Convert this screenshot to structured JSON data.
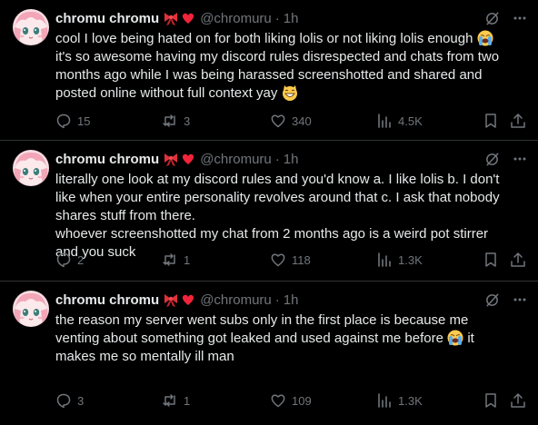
{
  "tweets": [
    {
      "author": {
        "name": "chromu chromu",
        "handle": "@chromuru",
        "time": "1h"
      },
      "lines": [
        "cool I love being hated on for both liking lolis or not liking lolis enough",
        "it's so awesome having my discord rules disrespected and chats from two",
        "months ago while I was being harassed screenshotted and shared and",
        "posted online without full context yay"
      ],
      "stats": {
        "replies": "15",
        "reposts": "3",
        "likes": "340",
        "views": "4.5K"
      }
    },
    {
      "author": {
        "name": "chromu chromu",
        "handle": "@chromuru",
        "time": "1h"
      },
      "lines": [
        "literally one look at my discord rules and you'd know a. I like lolis b. I don't",
        "like when your entire personality revolves around that c. I ask that nobody",
        "shares stuff from there.",
        "whoever screenshotted my chat from 2 months ago is a weird pot stirrer",
        "and you suck"
      ],
      "stats": {
        "replies": "2",
        "reposts": "1",
        "likes": "118",
        "views": "1.3K"
      }
    },
    {
      "author": {
        "name": "chromu chromu",
        "handle": "@chromuru",
        "time": "1h"
      },
      "lines": [
        "the reason my server went subs only in the first place is because me",
        "venting about something got leaked and used against me before",
        "makes me so mentally ill man"
      ],
      "stats": {
        "replies": "3",
        "reposts": "1",
        "likes": "109",
        "views": "1.3K"
      }
    }
  ],
  "icons": {
    "badges": [
      "ribbon-emoji-icon",
      "heart-emoji-icon"
    ],
    "crying_emoji": "loudly-crying-emoji-icon",
    "grin_emoji": "grinning-cat-emoji-icon"
  },
  "colors": {
    "background": "#000000",
    "text": "#e7e9ea",
    "muted": "#71767b",
    "divider": "#2f3336"
  }
}
